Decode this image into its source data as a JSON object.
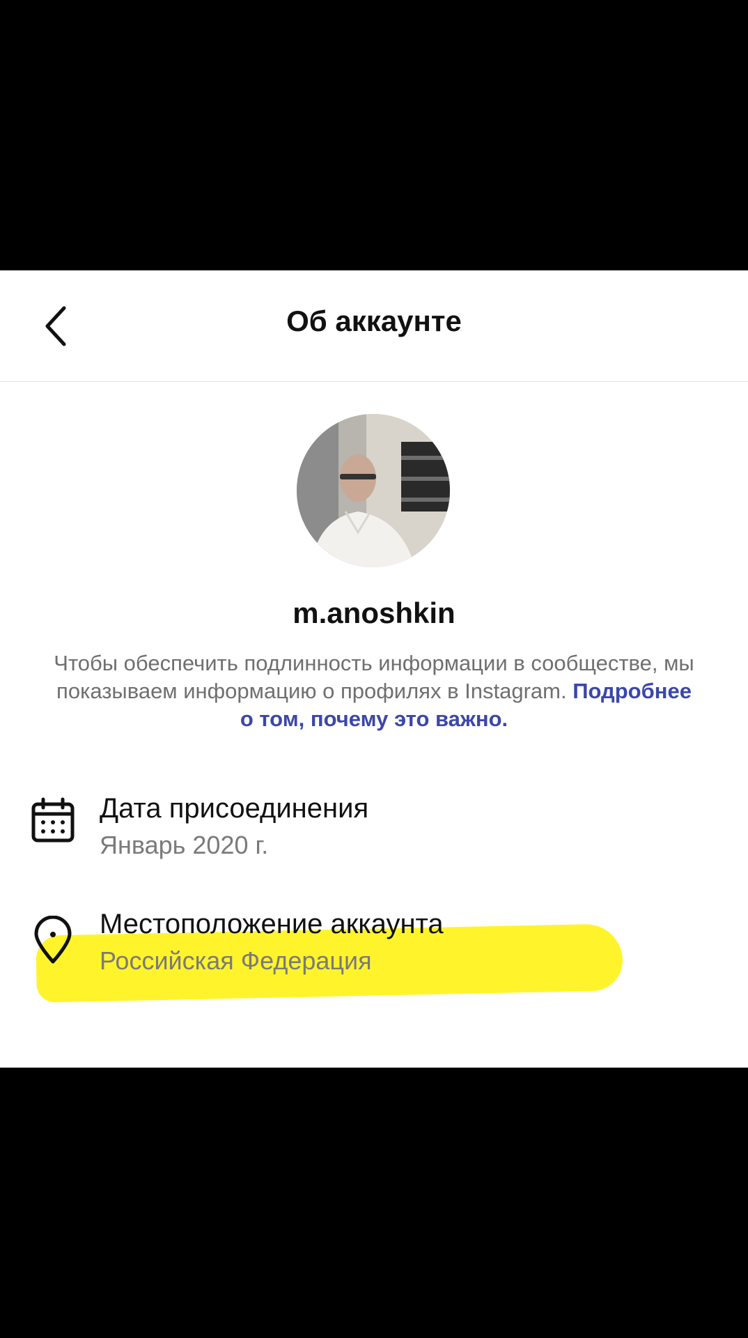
{
  "header": {
    "title": "Об аккаунте"
  },
  "profile": {
    "username": "m.anoshkin",
    "avatar_icon": "profile-photo"
  },
  "info": {
    "text": "Чтобы обеспечить подлинность информации в сообществе, мы показываем информацию о профилях в Instagram. ",
    "link": "Подробнее о том, почему это важно."
  },
  "details": {
    "join_date": {
      "icon": "calendar-icon",
      "title": "Дата присоединения",
      "value": "Январь 2020 г."
    },
    "location": {
      "icon": "location-pin-icon",
      "title": "Местоположение аккаунта",
      "value": "Российская Федерация"
    }
  },
  "colors": {
    "link": "#3b47a8",
    "highlight": "#fff320",
    "secondary_text": "#7a7a7a"
  }
}
